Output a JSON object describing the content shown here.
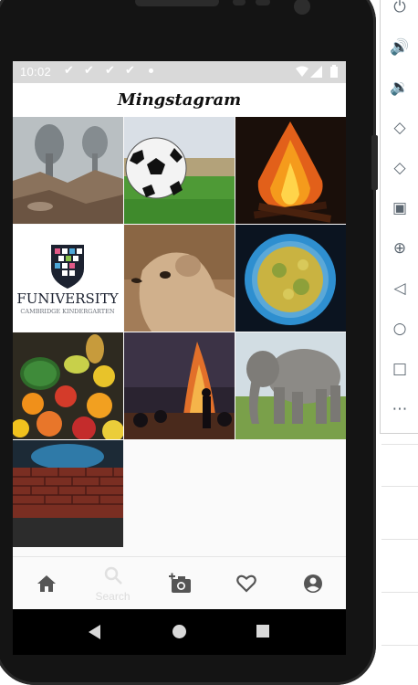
{
  "status_bar": {
    "time": "10:02"
  },
  "app": {
    "title": "Mingstagram"
  },
  "feed": {
    "tiles": [
      "explosion-smoke-photo",
      "soccer-ball-photo",
      "bonfire-photo",
      "funiversity-logo-photo",
      "meerkat-photo",
      "virus-microscope-photo",
      "fruit-pile-photo",
      "campfire-night-photo",
      "elephant-photo",
      "brick-wall-photo"
    ],
    "logo_text": {
      "name": "FUNIVERSITY",
      "subtitle": "CAMBRIDGE KINDERGARTEN"
    }
  },
  "bottom_nav": {
    "items": [
      {
        "icon": "home-icon",
        "label": ""
      },
      {
        "icon": "search-icon",
        "label": "Search"
      },
      {
        "icon": "add-photo-icon",
        "label": ""
      },
      {
        "icon": "heart-icon",
        "label": ""
      },
      {
        "icon": "account-icon",
        "label": ""
      }
    ]
  },
  "emulator_tools": [
    "power-icon",
    "volume-up-icon",
    "volume-down-icon",
    "rotate-left-icon",
    "rotate-right-icon",
    "camera-icon",
    "zoom-icon",
    "back-icon",
    "home-icon",
    "overview-icon",
    "more-icon"
  ]
}
